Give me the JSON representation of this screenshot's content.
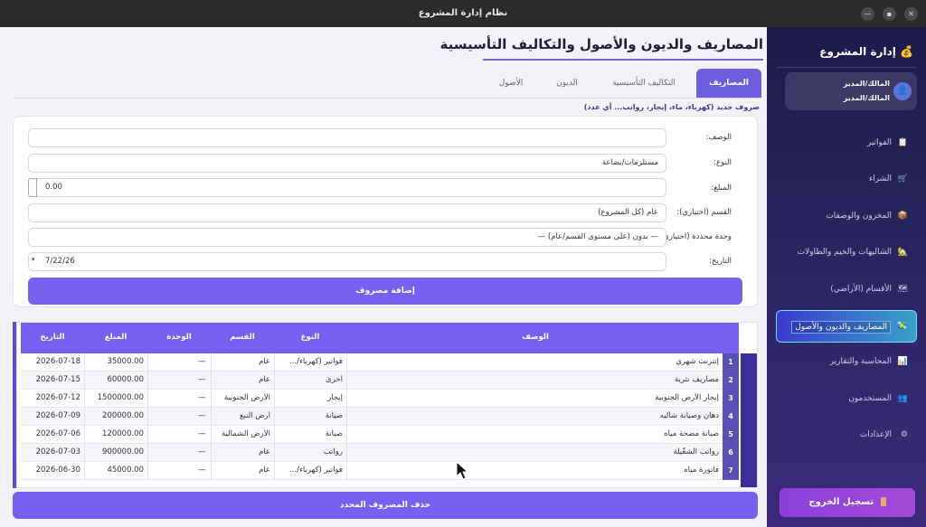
{
  "window": {
    "title": "نظام إدارة المشروع"
  },
  "sidebar": {
    "brand": "إدارة المشروع",
    "brand_icon": "💰",
    "user": {
      "line1": "المالك/المدير",
      "line2": "المالك/المدير"
    },
    "items": [
      {
        "label": "الفواتير",
        "icon": "📋"
      },
      {
        "label": "الشراء",
        "icon": "🛒"
      },
      {
        "label": "المخزون والوصفات",
        "icon": "📦"
      },
      {
        "label": "الشاليهات والخيم والطاولات",
        "icon": "🏡"
      },
      {
        "label": "الأقسام (الأراضي)",
        "icon": "🗺"
      },
      {
        "label": "المصاريف والديون والأصول",
        "icon": "💸"
      },
      {
        "label": "المحاسبة والتقارير",
        "icon": "📊"
      },
      {
        "label": "المستخدمون",
        "icon": "👥"
      },
      {
        "label": "الإعدادات",
        "icon": "⚙"
      }
    ],
    "logout": "تسجيل الخروج"
  },
  "main": {
    "title": "المصاريف والديون والأصول والتكاليف التأسيسية",
    "tabs": [
      "المصاريف",
      "التكاليف التأسيسية",
      "الديون",
      "الأصول"
    ],
    "subtitle": "صروف جديد (كهرباء، ماء، إيجار، رواتب... أي عدد)",
    "form": {
      "description_label": "الوصف:",
      "description_value": "",
      "type_label": "النوع:",
      "type_value": "مستلزمات/بضاعة",
      "amount_label": "المبلغ:",
      "amount_value": "0.00",
      "section_label": "القسم (اختياري):",
      "section_value": "عام (كل المشروع)",
      "unit_label": "وحدة محددة (اختياري):",
      "unit_value": "— بدون (على مستوى القسم/عام) —",
      "date_label": "التاريخ:",
      "date_value": "7/22/26",
      "submit": "إضافة مصروف"
    },
    "table": {
      "headers": {
        "desc": "الوصف",
        "type": "النوع",
        "section": "القسم",
        "unit": "الوحدة",
        "amount": "المبلغ",
        "date": "التاريخ"
      },
      "rows": [
        {
          "n": "1",
          "desc": "إنترنت شهري",
          "type": "فواتير (كهرباء/...",
          "section": "عام",
          "unit": "—",
          "amount": "35000.00",
          "date": "2026-07-18"
        },
        {
          "n": "2",
          "desc": "مصاريف نثرية",
          "type": "أخرى",
          "section": "عام",
          "unit": "—",
          "amount": "60000.00",
          "date": "2026-07-15"
        },
        {
          "n": "3",
          "desc": "إيجار الأرض الجنوبية",
          "type": "إيجار",
          "section": "الأرض الجنوبية",
          "unit": "—",
          "amount": "1500000.00",
          "date": "2026-07-12"
        },
        {
          "n": "4",
          "desc": "دهان وصيانة شاليه",
          "type": "صيانة",
          "section": "أرض النبع",
          "unit": "—",
          "amount": "200000.00",
          "date": "2026-07-09"
        },
        {
          "n": "5",
          "desc": "صيانة مضخة مياه",
          "type": "صيانة",
          "section": "الأرض الشمالية",
          "unit": "—",
          "amount": "120000.00",
          "date": "2026-07-06"
        },
        {
          "n": "6",
          "desc": "رواتب الشغّيلة",
          "type": "رواتب",
          "section": "عام",
          "unit": "—",
          "amount": "900000.00",
          "date": "2026-07-03"
        },
        {
          "n": "7",
          "desc": "فاتورة مياه",
          "type": "فواتير (كهرباء/...",
          "section": "عام",
          "unit": "—",
          "amount": "45000.00",
          "date": "2026-06-30"
        }
      ]
    },
    "delete_button": "حذف المصروف المحدد"
  },
  "colors": {
    "accent": "#7560ef",
    "sidebar": "#2a2560",
    "active_nav": "#3aa0c8"
  }
}
